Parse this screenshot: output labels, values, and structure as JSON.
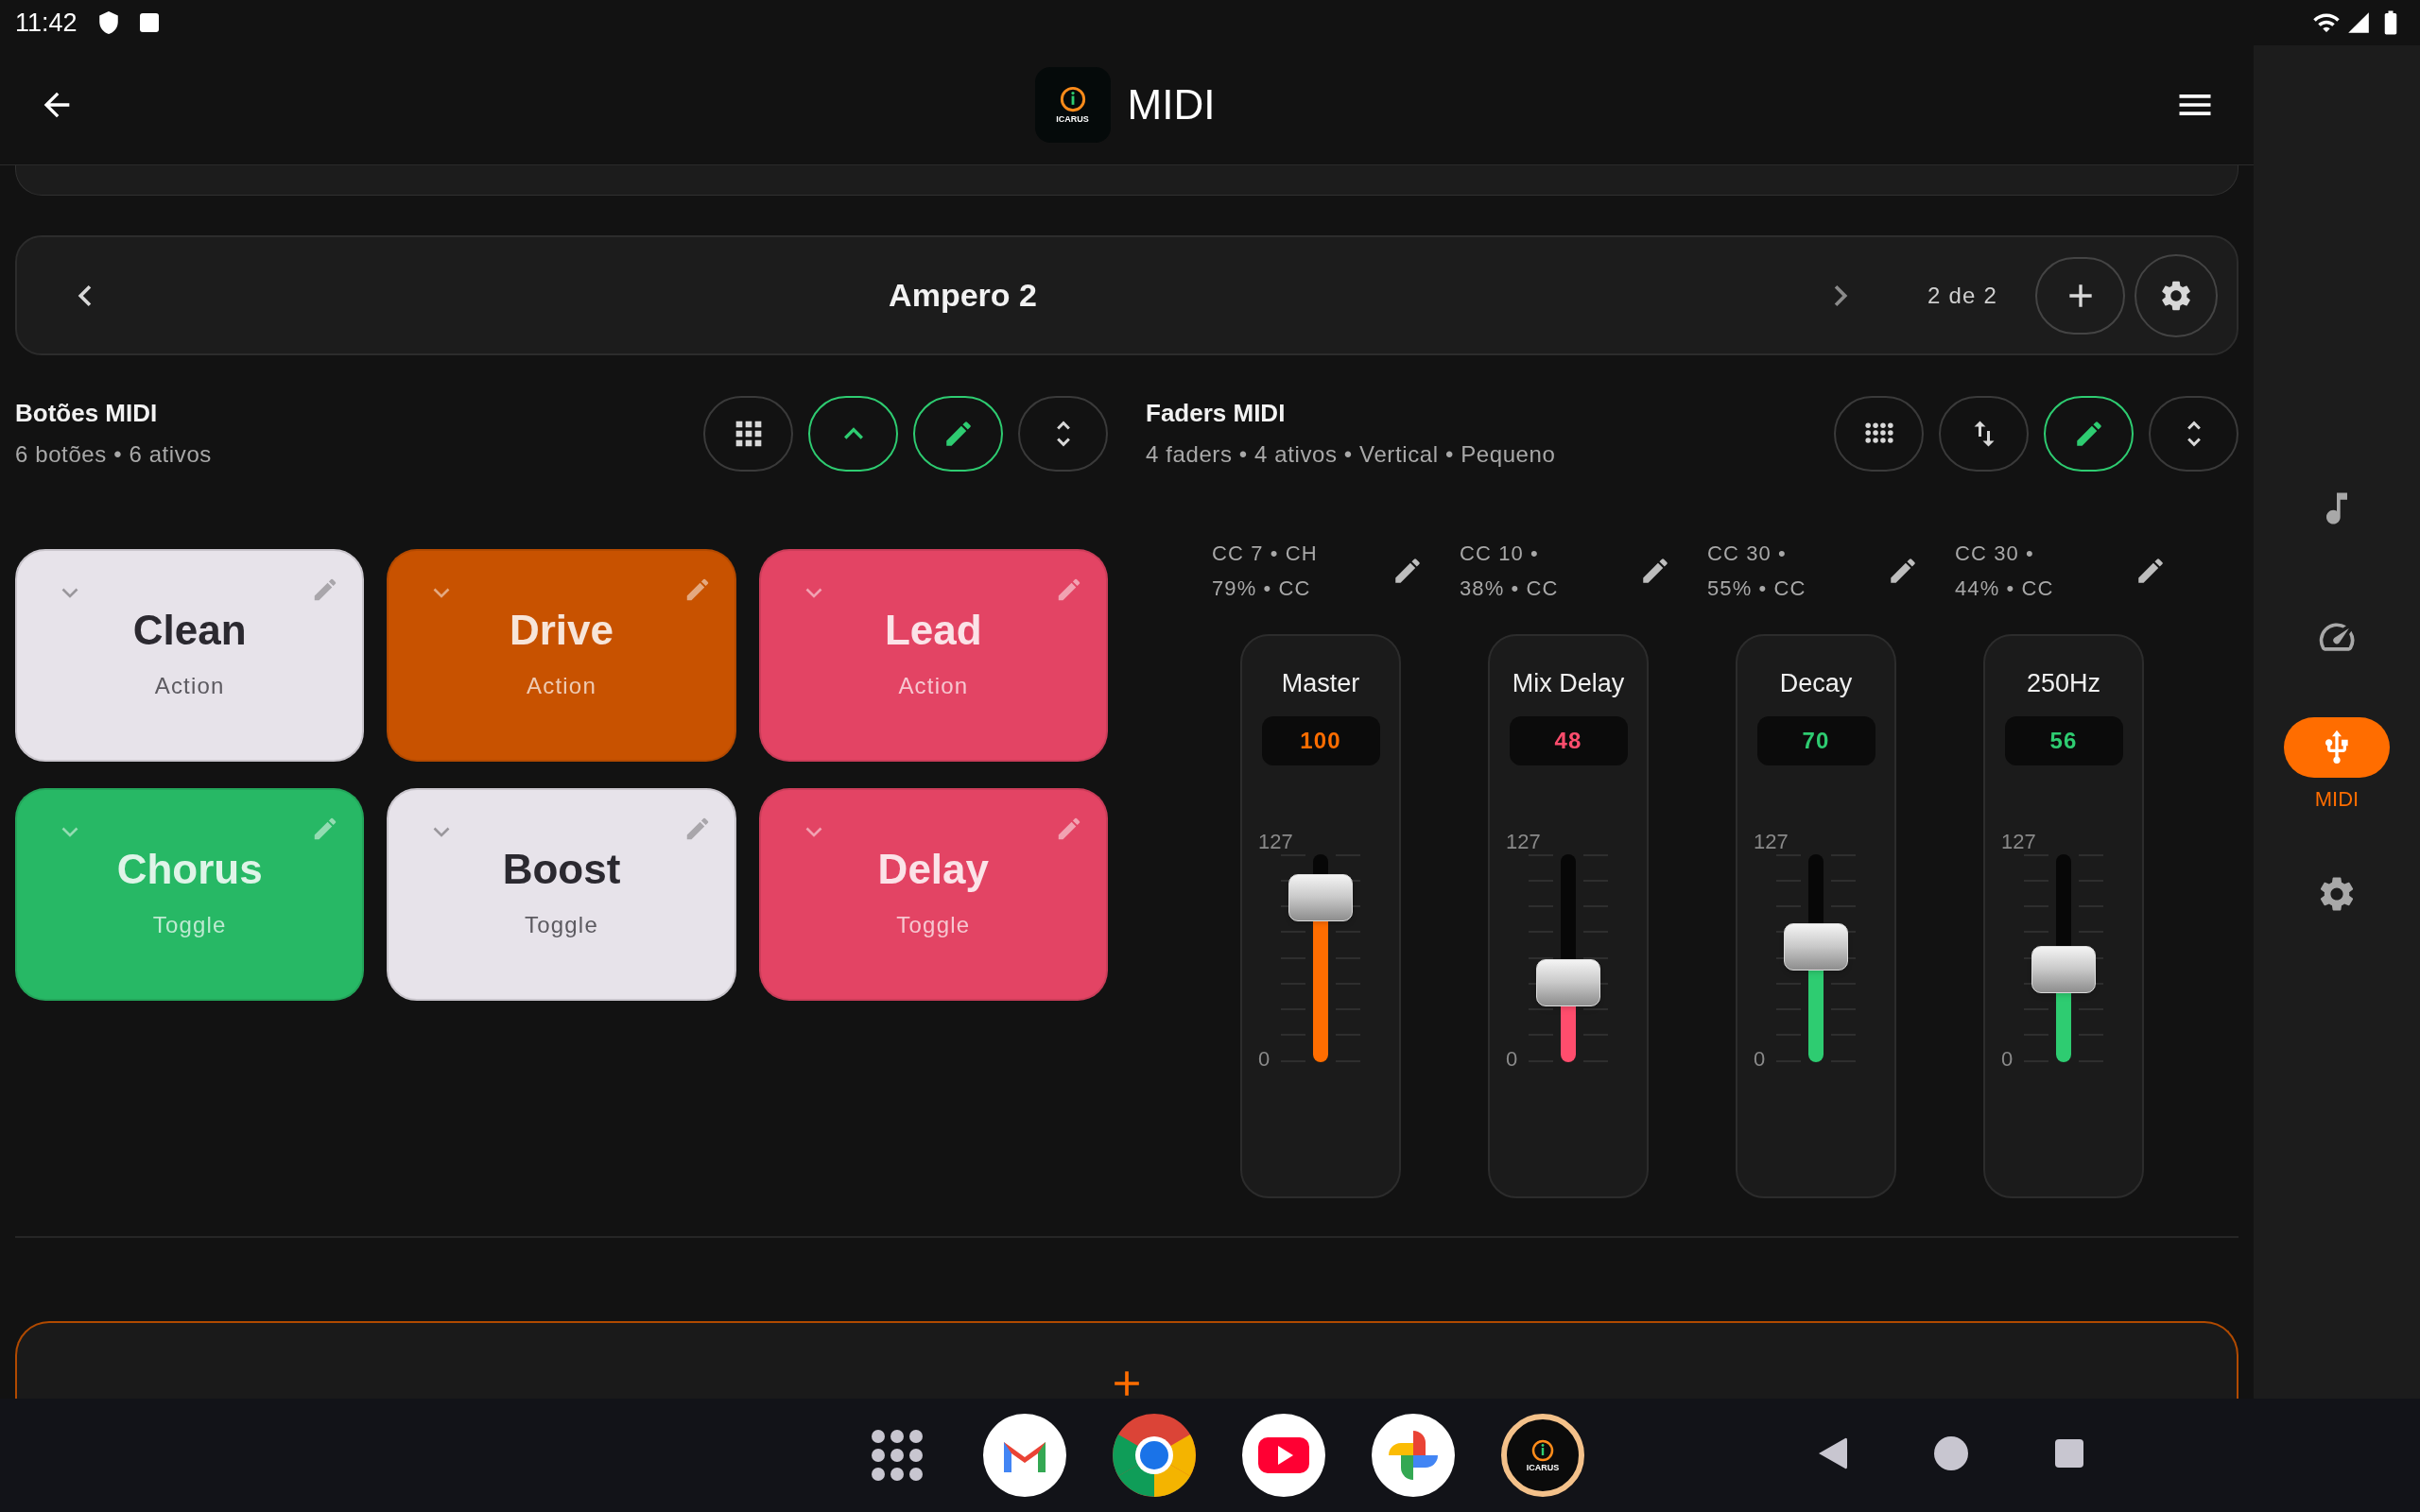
{
  "status_bar": {
    "time": "11:42"
  },
  "app_bar": {
    "logo_text": "ICARUS",
    "title": "MIDI"
  },
  "preset_bar": {
    "title": "Ampero 2",
    "page": "2 de 2"
  },
  "buttons_section": {
    "title": "Botões MIDI",
    "subtitle": "6 botões • 6 ativos",
    "tools": [
      {
        "kind": "grid",
        "on": false
      },
      {
        "kind": "collapse",
        "on": true
      },
      {
        "kind": "edit",
        "on": true
      },
      {
        "kind": "reorder",
        "on": false
      }
    ],
    "buttons": [
      {
        "label": "Clean",
        "type": "Action",
        "color": "#e7e3ea"
      },
      {
        "label": "Drive",
        "type": "Action",
        "color": "#c85200"
      },
      {
        "label": "Lead",
        "type": "Action",
        "color": "#e34464"
      },
      {
        "label": "Chorus",
        "type": "Toggle",
        "color": "#27b865"
      },
      {
        "label": "Boost",
        "type": "Toggle",
        "color": "#e7e3ea"
      },
      {
        "label": "Delay",
        "type": "Toggle",
        "color": "#e34464"
      }
    ]
  },
  "faders_section": {
    "title": "Faders MIDI",
    "subtitle": "4 faders • 4 ativos • Vertical • Pequeno",
    "tools": [
      {
        "kind": "dots",
        "on": false
      },
      {
        "kind": "swap",
        "on": false
      },
      {
        "kind": "edit",
        "on": true
      },
      {
        "kind": "reorder",
        "on": false
      }
    ],
    "faders": [
      {
        "info_line_1": "CC 7 • CH",
        "info_line_2": "79% • CC",
        "name": "Master",
        "value": "100",
        "scale_max": "127",
        "scale_min": "0",
        "level": 0.787,
        "color": "#ff6d00"
      },
      {
        "info_line_1": "CC 10 •",
        "info_line_2": "38% • CC",
        "name": "Mix Delay",
        "value": "48",
        "scale_max": "127",
        "scale_min": "0",
        "level": 0.378,
        "color": "#ff4d6d"
      },
      {
        "info_line_1": "CC 30 •",
        "info_line_2": "55% • CC",
        "name": "Decay",
        "value": "70",
        "scale_max": "127",
        "scale_min": "0",
        "level": 0.551,
        "color": "#2ecc71"
      },
      {
        "info_line_1": "CC 30 •",
        "info_line_2": "44% • CC",
        "name": "250Hz",
        "value": "56",
        "scale_max": "127",
        "scale_min": "0",
        "level": 0.441,
        "color": "#2ecc71"
      }
    ]
  },
  "rail": {
    "items": [
      {
        "kind": "music",
        "selected": false
      },
      {
        "kind": "gauge",
        "selected": false
      },
      {
        "kind": "usb",
        "label": "MIDI",
        "selected": true
      },
      {
        "kind": "settings",
        "selected": false
      }
    ]
  },
  "nav_bar": {
    "apps": [
      {
        "kind": "launcher"
      },
      {
        "kind": "mail"
      },
      {
        "kind": "browser"
      },
      {
        "kind": "video"
      },
      {
        "kind": "photos"
      },
      {
        "kind": "icarus",
        "label": "ICARUS"
      }
    ]
  }
}
